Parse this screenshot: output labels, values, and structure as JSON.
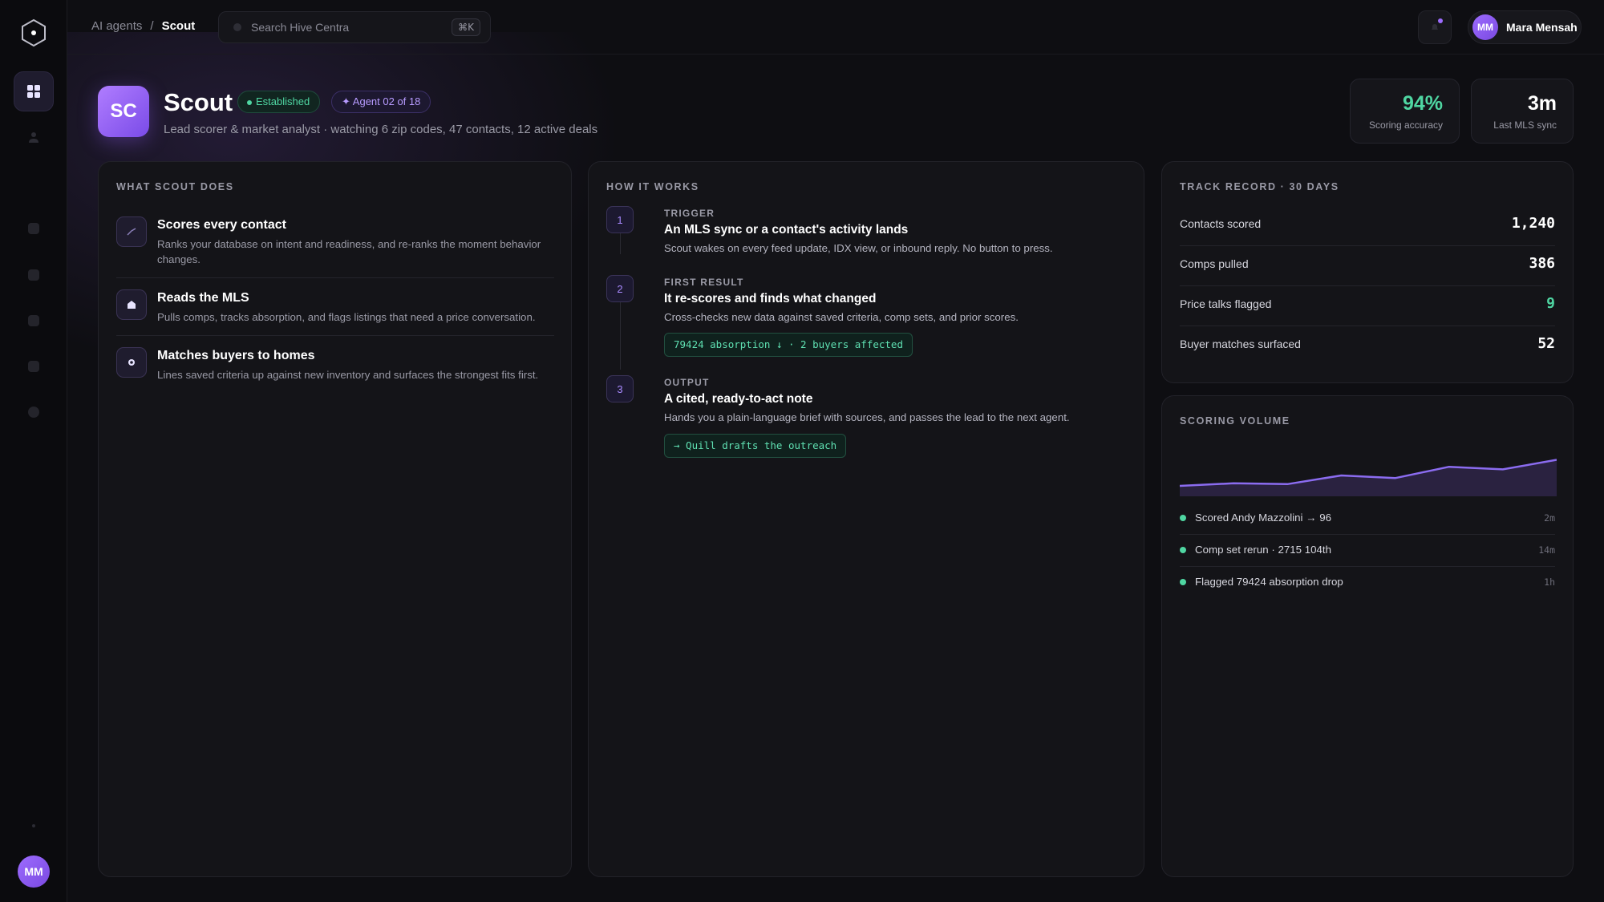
{
  "breadcrumb": {
    "parent": "AI agents",
    "separator": "/",
    "current": "Scout"
  },
  "search": {
    "placeholder": "Search Hive Centra",
    "shortcut": "⌘K"
  },
  "user": {
    "initials": "MM",
    "name": "Mara Mensah"
  },
  "agent": {
    "initials": "SC",
    "name": "Scout",
    "status_badge": "Established",
    "order_badge": "✦ Agent 02 of 18",
    "subtitle": "Lead scorer & market analyst · watching 6 zip codes, 47 contacts, 12 active deals"
  },
  "stats": [
    {
      "value": "94%",
      "label": "Scoring accuracy",
      "color": "#4fd6a2"
    },
    {
      "value": "3m",
      "label": "Last MLS sync",
      "color": "#ffffff"
    }
  ],
  "what_it_does": {
    "title": "WHAT SCOUT DOES",
    "items": [
      {
        "icon": "trend-icon",
        "title": "Scores every contact",
        "desc": "Ranks your database on intent and readiness, and re-ranks the moment behavior changes."
      },
      {
        "icon": "home-icon",
        "title": "Reads the MLS",
        "desc": "Pulls comps, tracks absorption, and flags listings that need a price conversation."
      },
      {
        "icon": "target-icon",
        "title": "Matches buyers to homes",
        "desc": "Lines saved criteria up against new inventory and surfaces the strongest fits first."
      }
    ]
  },
  "how_it_works": {
    "title": "HOW IT WORKS",
    "steps": [
      {
        "num": "1",
        "label": "TRIGGER",
        "title": "An MLS sync or a contact's activity lands",
        "desc": "Scout wakes on every feed update, IDX view, or inbound reply. No button to press."
      },
      {
        "num": "2",
        "label": "FIRST RESULT",
        "title": "It re-scores and finds what changed",
        "desc": "Cross-checks new data against saved criteria, comp sets, and prior scores.",
        "chip": "79424 absorption ↓ · 2 buyers affected"
      },
      {
        "num": "3",
        "label": "OUTPUT",
        "title": "A cited, ready-to-act note",
        "desc": "Hands you a plain-language brief with sources, and passes the lead to the next agent.",
        "chip": "→ Quill drafts the outreach"
      }
    ]
  },
  "track_record": {
    "title": "TRACK RECORD · 30 DAYS",
    "rows": [
      {
        "label": "Contacts scored",
        "value": "1,240"
      },
      {
        "label": "Comps pulled",
        "value": "386"
      },
      {
        "label": "Price talks flagged",
        "value": "9"
      },
      {
        "label": "Buyer matches surfaced",
        "value": "52"
      }
    ]
  },
  "scoring_volume": {
    "title": "SCORING VOLUME",
    "activity": [
      {
        "text": "Scored Andy Mazzolini → 96",
        "time": "2m"
      },
      {
        "text": "Comp set rerun · 2715 104th",
        "time": "14m"
      },
      {
        "text": "Flagged 79424 absorption drop",
        "time": "1h"
      }
    ]
  },
  "chart_data": {
    "type": "area",
    "x": [
      0,
      1,
      2,
      3,
      4,
      5,
      6,
      7
    ],
    "values": [
      12,
      15,
      14,
      24,
      21,
      34,
      31,
      42
    ],
    "ylim": [
      0,
      60
    ],
    "color": "#8b6cf0"
  },
  "colors": {
    "accent": "#9d6cff",
    "success": "#4fd6a2",
    "background": "#0e0e12",
    "card": "#141418"
  }
}
